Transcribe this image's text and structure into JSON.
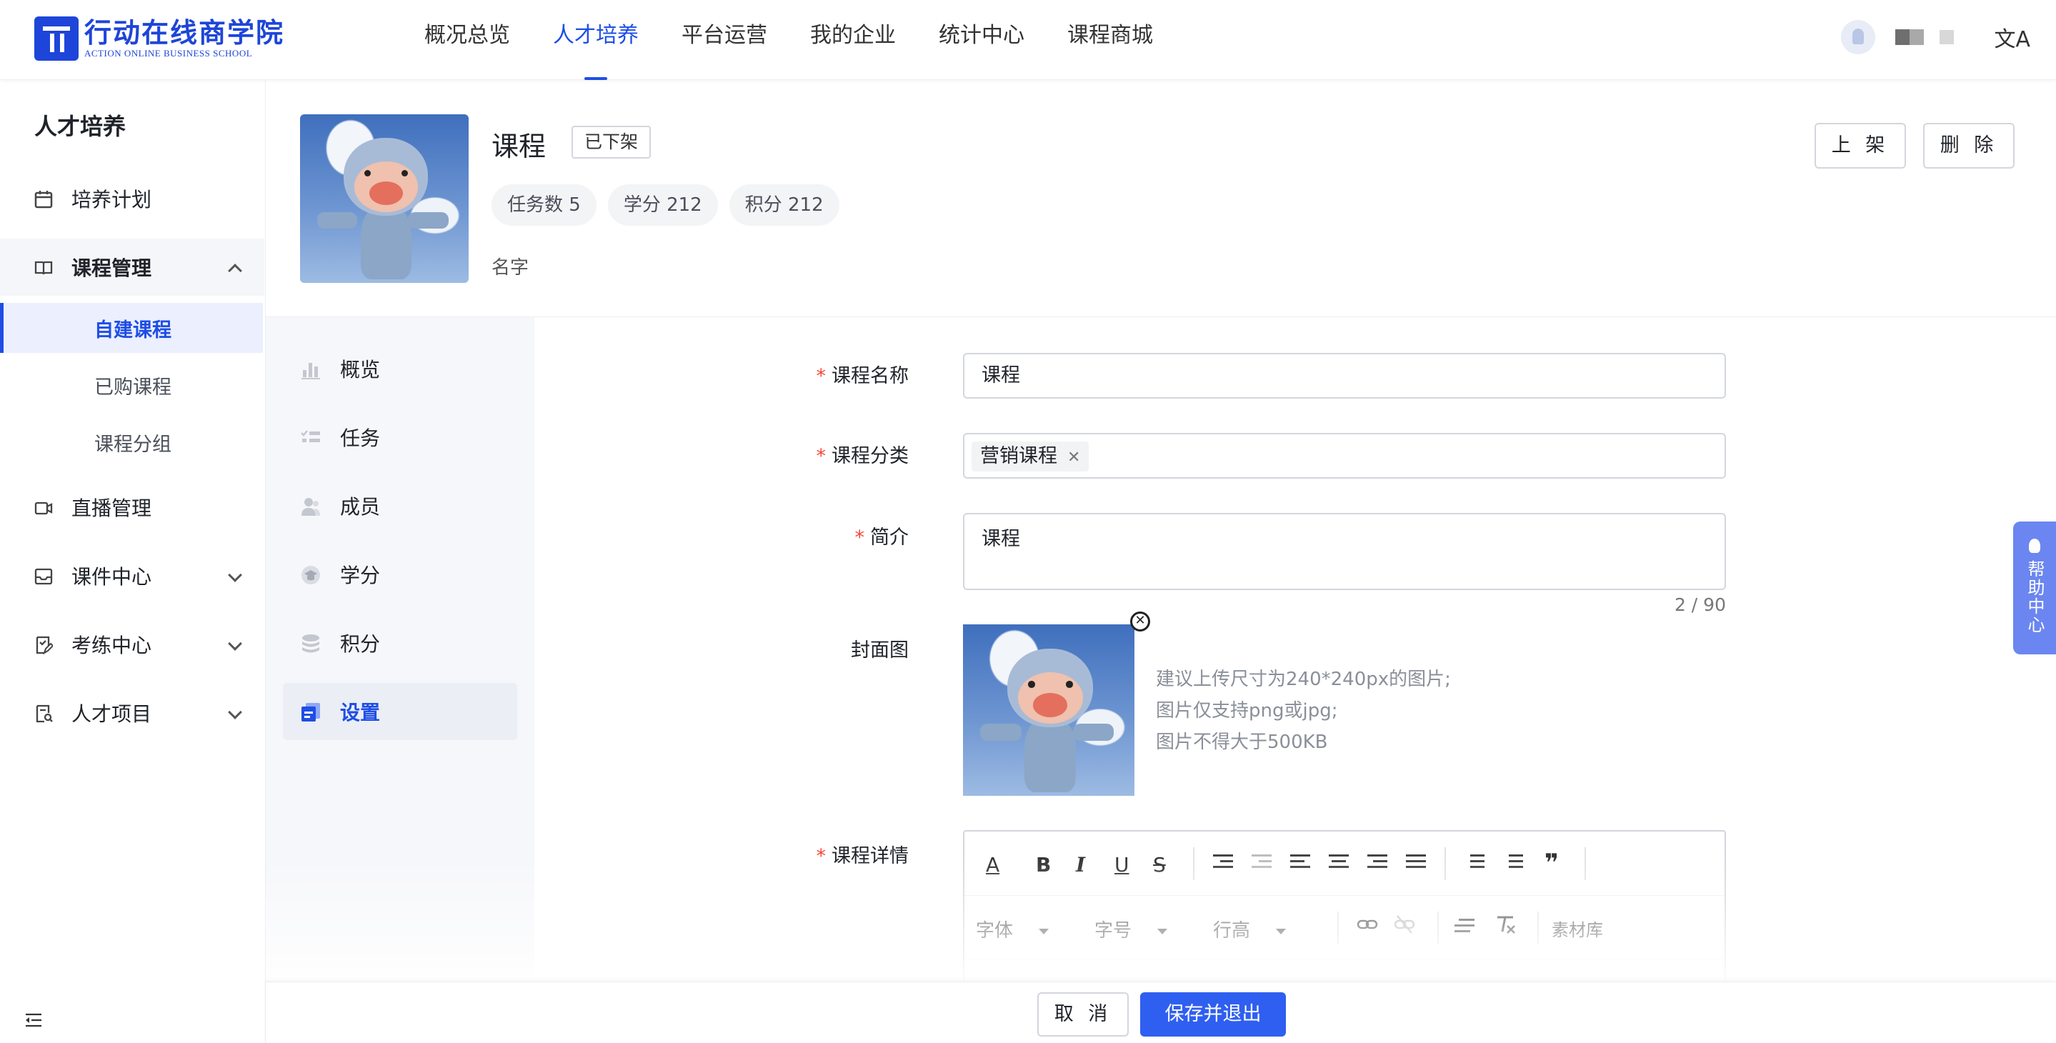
{
  "header": {
    "logo_cn": "行动在线商学院",
    "logo_en": "ACTION ONLINE BUSINESS SCHOOL",
    "nav": [
      {
        "label": "概况总览"
      },
      {
        "label": "人才培养",
        "active": true
      },
      {
        "label": "平台运营"
      },
      {
        "label": "我的企业"
      },
      {
        "label": "统计中心"
      },
      {
        "label": "课程商城"
      }
    ],
    "lang_icon": "文A"
  },
  "sidebar": {
    "title": "人才培养",
    "items": [
      {
        "label": "培养计划",
        "icon": "calendar-icon"
      },
      {
        "label": "课程管理",
        "icon": "book-icon",
        "expanded": true
      },
      {
        "label": "直播管理",
        "icon": "video-icon"
      },
      {
        "label": "课件中心",
        "icon": "inbox-icon"
      },
      {
        "label": "考练中心",
        "icon": "exam-icon"
      },
      {
        "label": "人才项目",
        "icon": "project-icon"
      }
    ],
    "subitems": [
      {
        "label": "自建课程",
        "active": true
      },
      {
        "label": "已购课程"
      },
      {
        "label": "课程分组"
      }
    ]
  },
  "course": {
    "title": "课程",
    "status": "已下架",
    "tags": [
      "任务数 5",
      "学分 212",
      "积分 212"
    ],
    "name": "名字",
    "publish_label": "上 架",
    "delete_label": "删 除"
  },
  "subnav": [
    {
      "label": "概览",
      "icon": "bar-chart-icon"
    },
    {
      "label": "任务",
      "icon": "task-list-icon"
    },
    {
      "label": "成员",
      "icon": "members-icon"
    },
    {
      "label": "学分",
      "icon": "credit-icon"
    },
    {
      "label": "积分",
      "icon": "coins-icon"
    },
    {
      "label": "设置",
      "icon": "settings-doc-icon",
      "active": true
    }
  ],
  "form": {
    "course_name_label": "课程名称",
    "course_name_value": "课程",
    "category_label": "课程分类",
    "category_chip": "营销课程",
    "intro_label": "简介",
    "intro_value": "课程",
    "intro_counter": "2 / 90",
    "cover_label": "封面图",
    "cover_hints": [
      "建议上传尺寸为240*240px的图片;",
      "图片仅支持png或jpg;",
      "图片不得大于500KB"
    ],
    "detail_label": "课程详情",
    "required_mark": "*"
  },
  "editor": {
    "font_label": "字体",
    "size_label": "字号",
    "lineheight_label": "行高",
    "library_label": "素材库",
    "bold": "B",
    "italic": "I",
    "underline": "U",
    "strike": "S",
    "text_color": "A",
    "quote": "❞"
  },
  "footer": {
    "cancel_label": "取 消",
    "save_label": "保存并退出"
  },
  "help": {
    "label": "帮助中心"
  },
  "colors": {
    "brand": "#1e45d9",
    "accent": "#1e4ee6",
    "primary_button": "#2f5ff0",
    "required": "#f5483b",
    "help_tab": "#6b86f0"
  }
}
